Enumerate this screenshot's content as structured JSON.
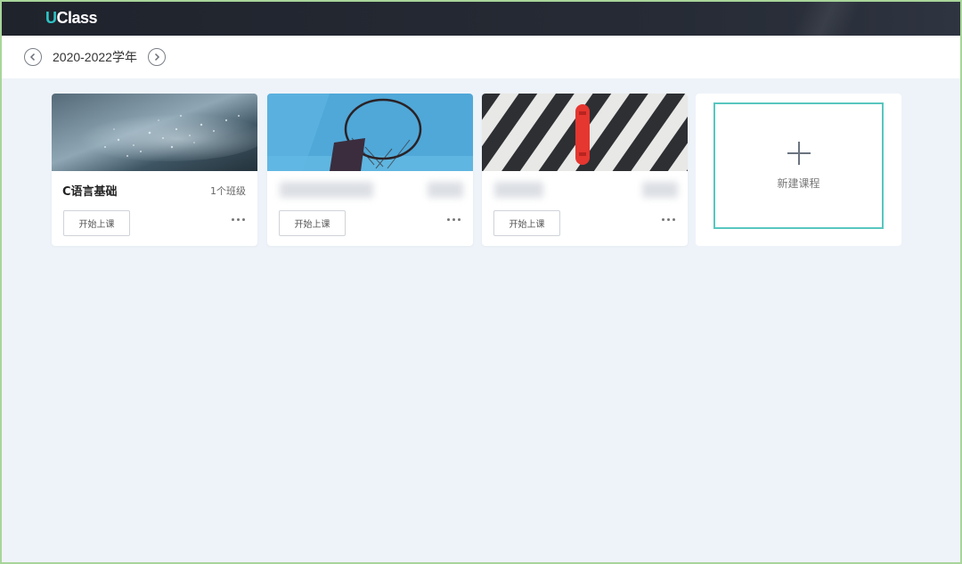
{
  "app": {
    "logo_u": "U",
    "logo_rest": "Class"
  },
  "year_selector": {
    "label": "2020-2022学年"
  },
  "courses": [
    {
      "title": "C语言基础",
      "class_count": "1个班级",
      "start_label": "开始上课",
      "cover": "rain-droplets"
    },
    {
      "title": "",
      "class_count": "",
      "start_label": "开始上课",
      "cover": "basketball-hoop",
      "blurred": true
    },
    {
      "title": "",
      "class_count": "",
      "start_label": "开始上课",
      "cover": "striped-skateboard",
      "blurred": true
    }
  ],
  "new_course": {
    "label": "新建课程"
  },
  "colors": {
    "accent": "#58c6bf",
    "logo_accent": "#2ec4c6",
    "topbar": "#1f232c",
    "background": "#eef3f9"
  },
  "icons": [
    "chevron-left-icon",
    "chevron-right-icon",
    "more-dots-icon",
    "plus-icon"
  ]
}
